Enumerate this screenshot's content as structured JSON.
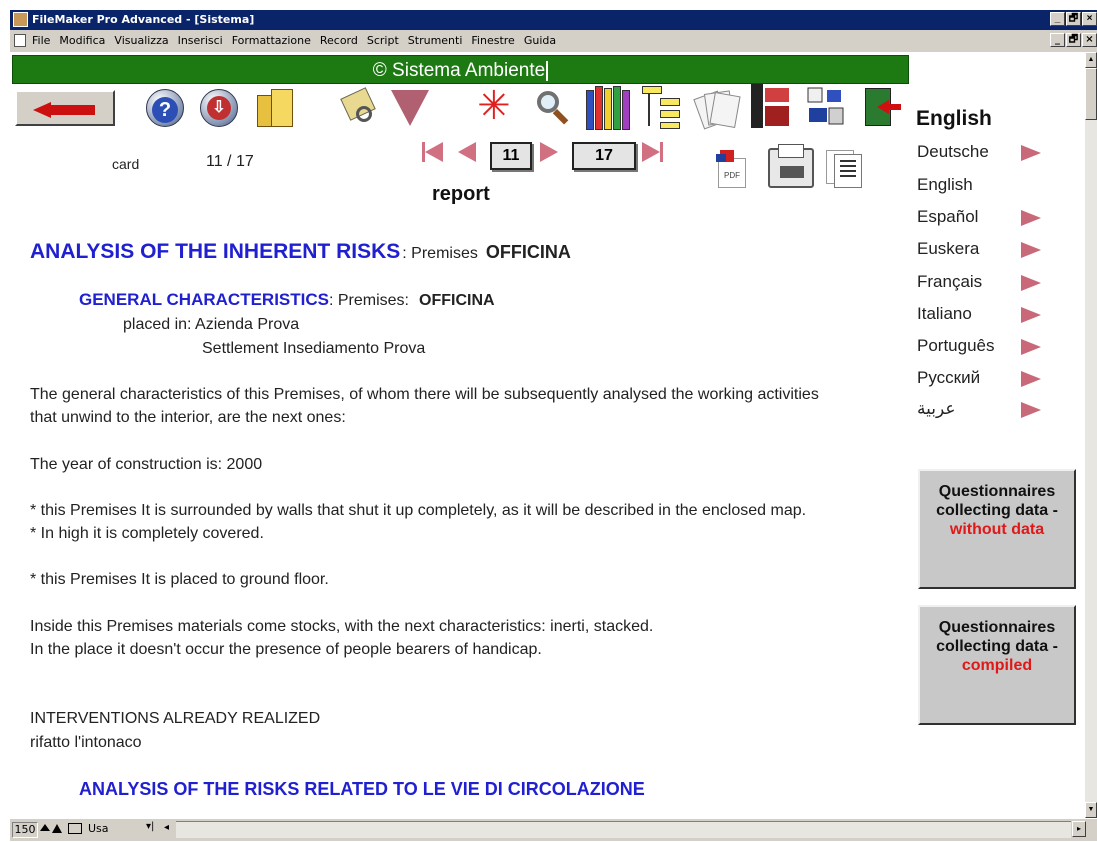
{
  "window": {
    "title": "FileMaker Pro Advanced - [Sistema]",
    "controls": [
      "_",
      "🗗",
      "×"
    ]
  },
  "menu": [
    "File",
    "Modifica",
    "Visualizza",
    "Inserisci",
    "Formattazione",
    "Record",
    "Script",
    "Strumenti",
    "Finestre",
    "Guida"
  ],
  "header": {
    "banner": "© Sistema Ambiente"
  },
  "toolbar": {
    "icons": [
      "back-icon",
      "help-icon",
      "download-icon",
      "doors-icon",
      "key-icon",
      "filter-icon",
      "asterisk-icon",
      "search-icon",
      "books-icon",
      "database-tree-icon",
      "papers-icon",
      "film-icon",
      "disk-icon",
      "exit-icon"
    ],
    "star_glyph": "✳"
  },
  "record": {
    "card_label": "card",
    "position": "11 / 17",
    "current": "11",
    "total": "17",
    "report_label": "report"
  },
  "document": {
    "main_heading": "ANALYSIS OF THE INHERENT RISKS",
    "main_heading_sub": ": Premises",
    "main_heading_value": "OFFICINA",
    "section_heading": "GENERAL CHARACTERISTICS",
    "section_heading_sub": ": Premises:",
    "section_heading_value": "OFFICINA",
    "placed_in": "placed in: Azienda Prova",
    "settlement": "Settlement  Insediamento Prova",
    "para1_line1": "The general characteristics of this Premises, of whom there will be subsequently analysed the working activities",
    "para1_line2": "that unwind to the interior, are the next ones:",
    "year": "The year of construction is: 2000",
    "walls": "* this Premises It is surrounded by walls that shut it up completely, as it will be described in the enclosed map.",
    "covered": "* In high it is completely covered.",
    "ground": "* this Premises It is placed to ground floor.",
    "materials": "Inside this Premises materials come stocks, with the next characteristics: inerti, stacked.",
    "handicap": "In the place it doesn't occur the presence of people bearers of handicap.",
    "interventions_title": "INTERVENTIONS ALREADY REALIZED",
    "interventions_value": "rifatto l'intonaco",
    "next_heading": "ANALYSIS OF THE RISKS RELATED TO LE VIE DI CIRCOLAZIONE"
  },
  "languages": {
    "current": "English",
    "items": [
      {
        "label": "Deutsche",
        "arrow": true
      },
      {
        "label": "English",
        "arrow": false
      },
      {
        "label": "Español",
        "arrow": true
      },
      {
        "label": "Euskera",
        "arrow": true
      },
      {
        "label": "Français",
        "arrow": true
      },
      {
        "label": "Italiano",
        "arrow": true
      },
      {
        "label": "Português",
        "arrow": true
      },
      {
        "label": "Русский",
        "arrow": true
      },
      {
        "label": "عربية",
        "arrow": true
      }
    ]
  },
  "questionnaires": [
    {
      "line1": "Questionnaires",
      "line2": "collecting data -",
      "status": "without data",
      "status_color": "#e01818"
    },
    {
      "line1": "Questionnaires",
      "line2": "collecting data -",
      "status": "compiled",
      "status_color": "#e01818"
    }
  ],
  "statusbar": {
    "zoom": "150",
    "mode": "Usa"
  },
  "colors": {
    "banner_bg": "#1d7a12",
    "heading_blue": "#2020d0",
    "nav_pink": "#d07080",
    "title_bar": "#0a246a"
  }
}
